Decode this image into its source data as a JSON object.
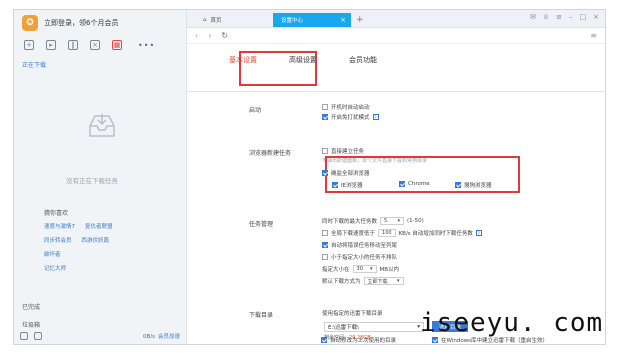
{
  "left": {
    "title": "立即登录，领6个月会员",
    "tab_downloading": "正在下载",
    "empty_text": "没有正在下载任务",
    "recommend_title": "猜你喜欢",
    "recommend_row1": [
      "速度与激情7",
      "复仇者联盟",
      "同步转会员"
    ],
    "recommend_row2": [
      "西游伏妖篇",
      "破坏者"
    ],
    "recommend_row3": [
      "记忆大师"
    ],
    "side_done": "已完成",
    "side_trash": "垃圾箱",
    "speed": "0B/s",
    "vip": "会员加速"
  },
  "browser": {
    "tab_home": "首页",
    "tab_settings": "设置中心",
    "tab_close": "×",
    "tab_add": "+"
  },
  "settings": {
    "tabs": [
      "基本设置",
      "高级设置",
      "会员功能"
    ],
    "startup": {
      "label": "启动",
      "opt1": "开机时自动启动",
      "opt2": "开启免打扰模式"
    },
    "browser_task": {
      "label": "浏览器新建任务",
      "opt1": "直接建立任务",
      "hint": "不弹出新建面板，单个文件直接下载到常用目录",
      "opt2": "确监全部浏览器",
      "ie": "IE浏览器",
      "chrome": "Chrome",
      "sogou": "搜狗浏览器"
    },
    "task_mgmt": {
      "label": "任务管理",
      "max_tasks_label": "同时下载的最大任务数",
      "max_tasks_value": "5",
      "max_tasks_range": "(1-50)",
      "speed_prefix": "全局下载速度低于",
      "speed_value": "100",
      "speed_suffix": "KB/s 自动增加同时下载任务数",
      "auto_move": "自动将错误任务移动至列尾",
      "small_task": "小于指定大小的任务不排队",
      "size_label": "指定大小在",
      "size_value": "30",
      "size_unit": "MB以内",
      "default_mode_label": "默认下载方式为",
      "default_mode_value": "立即下载"
    },
    "download_dir": {
      "label": "下载目录",
      "use_recent": "使用指定的迅雷下载目录",
      "path": "E:\\迅雷下载\\",
      "choose_btn": "选择目录",
      "free_label": "剩余空间：",
      "free_value": "29.28GB",
      "auto_last": "自动修改为上次使用的目录",
      "win_create": "在Windows库中建立迅雷下载（重启生效）"
    }
  },
  "watermark": "iseeyu. com",
  "colors": {
    "accent": "#19a7f0",
    "highlight": "#e0393a",
    "link": "#3a7bd5"
  }
}
